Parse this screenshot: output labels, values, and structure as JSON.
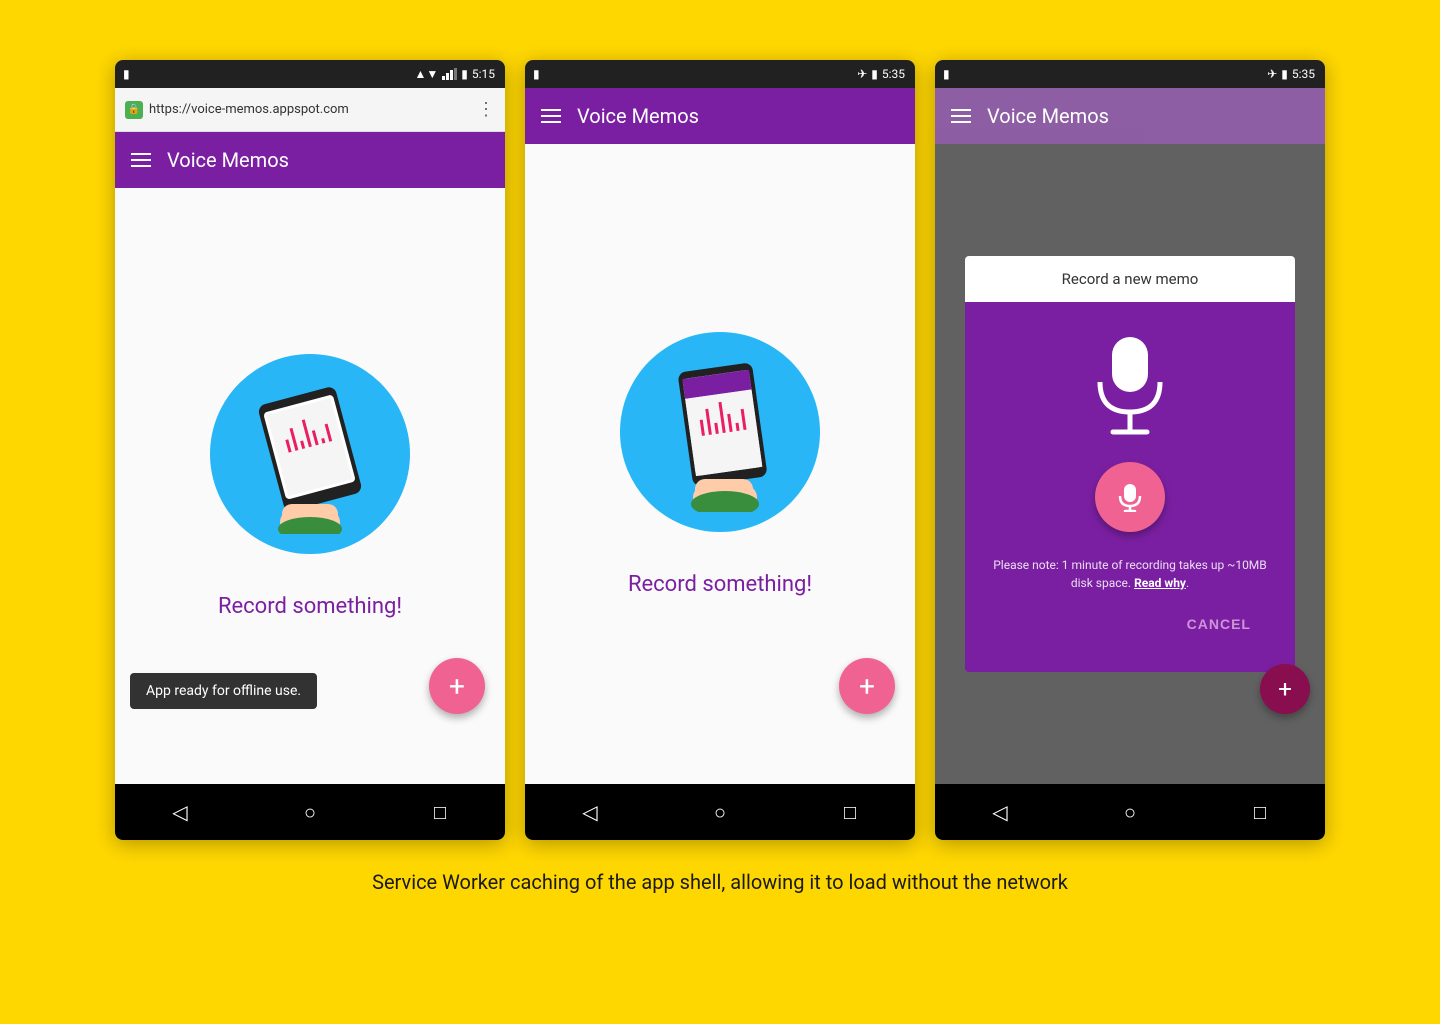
{
  "background_color": "#FFD700",
  "caption": "Service Worker caching of the app shell, allowing it to load without the network",
  "phones": [
    {
      "id": "phone1",
      "status_bar": {
        "time": "5:15",
        "has_wifi": true,
        "has_signal": true,
        "has_battery": true,
        "has_phone_icon": true
      },
      "address_bar": {
        "url": "https://voice-memos.appspot.com",
        "has_lock": true
      },
      "app_bar": {
        "title": "Voice Memos"
      },
      "main": {
        "record_label": "Record something!"
      },
      "snackbar": "App ready for offline use.",
      "fab_label": "+"
    },
    {
      "id": "phone2",
      "status_bar": {
        "time": "5:35",
        "has_airplane": true,
        "has_battery": true
      },
      "app_bar": {
        "title": "Voice Memos"
      },
      "main": {
        "record_label": "Record something!"
      },
      "fab_label": "+"
    },
    {
      "id": "phone3",
      "status_bar": {
        "time": "5:35",
        "has_airplane": true,
        "has_battery": true
      },
      "app_bar": {
        "title": "Voice Memos"
      },
      "dialog": {
        "header": "Record a new memo",
        "note": "Please note: 1 minute of recording takes up ~10MB disk space.",
        "read_why": "Read why",
        "cancel_label": "CANCEL"
      },
      "fab_label": "+"
    }
  ],
  "nav": {
    "back_icon": "◁",
    "home_icon": "○",
    "recents_icon": "□"
  }
}
